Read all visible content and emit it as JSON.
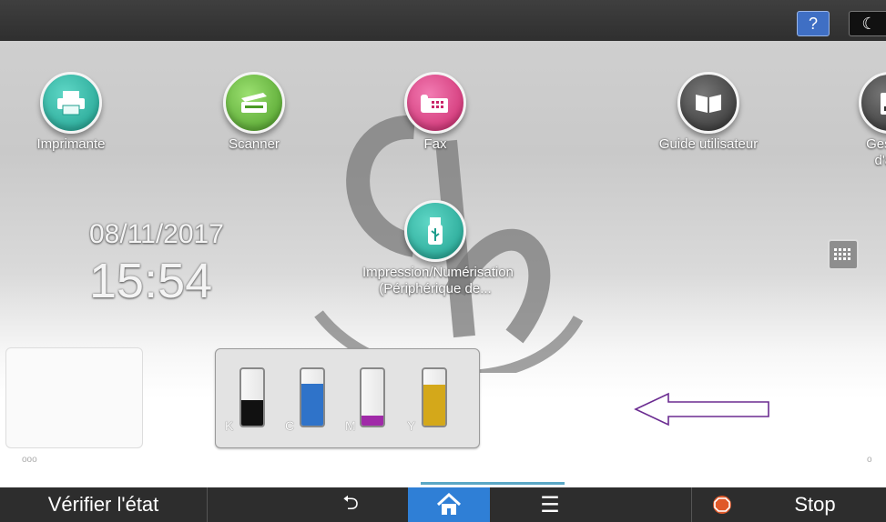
{
  "topbar": {
    "help_label": "?",
    "sleep_label": "☾"
  },
  "apps": [
    {
      "label": "Imprimante",
      "icon": "printer-icon",
      "color": "#2fb7a5"
    },
    {
      "label": "Scanner",
      "icon": "scanner-icon",
      "color": "#66b33a"
    },
    {
      "label": "Fax",
      "icon": "fax-icon",
      "color": "#e0468a"
    },
    {
      "label": "Guide utilisateur",
      "icon": "book-icon",
      "color": "#555555"
    },
    {
      "label": "Gestion\nd'adr",
      "icon": "address-book-icon",
      "color": "#555555"
    },
    {
      "label": "Impression/Numérisation\n(Périphérique de...",
      "icon": "usb-icon",
      "color": "#2fb7a5"
    }
  ],
  "datetime": {
    "date": "08/11/2017",
    "time": "15:54"
  },
  "ink": {
    "levels": [
      {
        "letter": "K",
        "color": "#111111",
        "level": 0.45
      },
      {
        "letter": "C",
        "color": "#2f73c9",
        "level": 0.75
      },
      {
        "letter": "M",
        "color": "#a02aa8",
        "level": 0.18
      },
      {
        "letter": "Y",
        "color": "#d4a81a",
        "level": 0.72
      }
    ]
  },
  "pager": {
    "left": "ooo",
    "right": "o"
  },
  "bottombar": {
    "verify_label": "Vérifier l'état",
    "back_label": "⮌",
    "menu_label": "☰",
    "stop_label": "Stop"
  }
}
